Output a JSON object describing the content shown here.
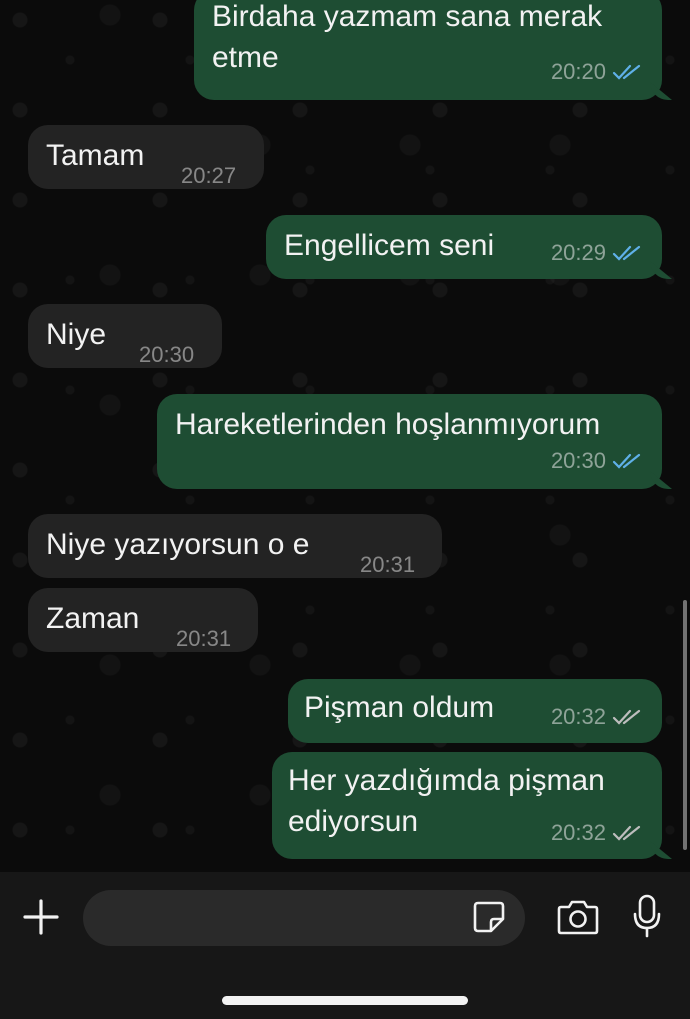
{
  "messages": [
    {
      "direction": "outgoing",
      "text": "Birdaha yazmam sana merak\netme",
      "time": "20:20",
      "status": "read"
    },
    {
      "direction": "incoming",
      "text": "Tamam",
      "time": "20:27"
    },
    {
      "direction": "outgoing",
      "text": "Engellicem seni",
      "time": "20:29",
      "status": "read"
    },
    {
      "direction": "incoming",
      "text": "Niye",
      "time": "20:30"
    },
    {
      "direction": "outgoing",
      "text": "Hareketlerinden hoşlanmıyorum",
      "time": "20:30",
      "status": "read"
    },
    {
      "direction": "incoming",
      "text": "Niye yazıyorsun o e",
      "time": "20:31"
    },
    {
      "direction": "incoming",
      "text": "Zaman",
      "time": "20:31"
    },
    {
      "direction": "outgoing",
      "text": "Pişman oldum",
      "time": "20:32",
      "status": "delivered"
    },
    {
      "direction": "outgoing",
      "text": "Her yazdığımda pişman\nediyorsun",
      "time": "20:32",
      "status": "delivered"
    }
  ],
  "colors": {
    "outgoing_bubble": "#1e4d33",
    "incoming_bubble": "#232323",
    "read_tick": "#5fb0e8",
    "delivered_tick": "#bdbdbd"
  },
  "input_bar": {
    "icons": [
      "plus-icon",
      "sticker-icon",
      "camera-icon",
      "microphone-icon"
    ]
  }
}
